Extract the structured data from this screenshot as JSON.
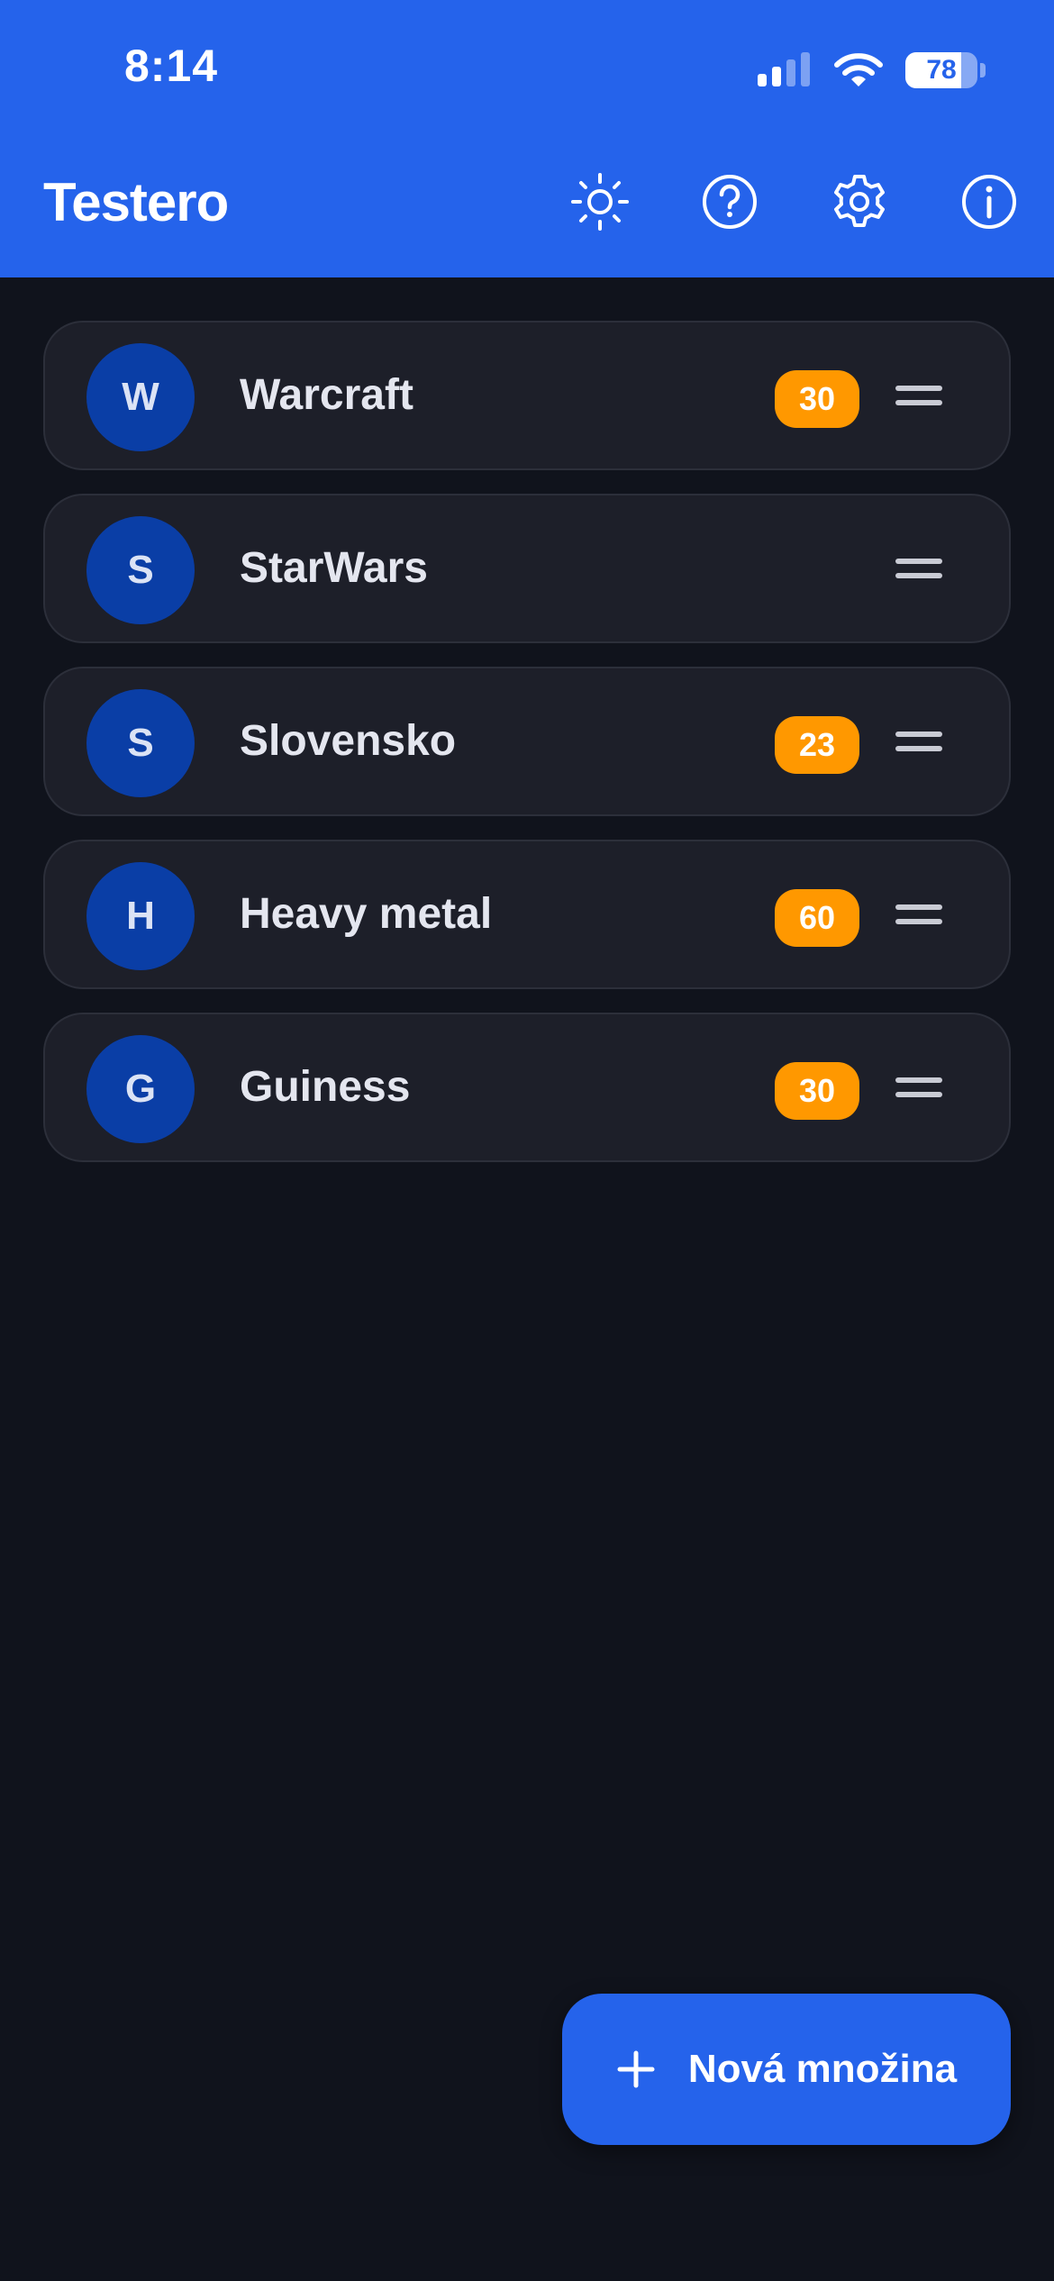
{
  "status_bar": {
    "time": "8:14",
    "battery": "78",
    "battery_level": 0.78
  },
  "header": {
    "title": "Testero",
    "icons": [
      "sun-icon",
      "help-icon",
      "settings-icon",
      "info-icon"
    ]
  },
  "sets": [
    {
      "initial": "W",
      "name": "Warcraft",
      "count": "30"
    },
    {
      "initial": "S",
      "name": "StarWars",
      "count": ""
    },
    {
      "initial": "S",
      "name": "Slovensko",
      "count": "23"
    },
    {
      "initial": "H",
      "name": "Heavy metal",
      "count": "60"
    },
    {
      "initial": "G",
      "name": "Guiness",
      "count": "30"
    }
  ],
  "fab": {
    "label": "Nová množina"
  },
  "colors": {
    "accent": "#2563eb",
    "background": "#10131c",
    "card": "#1d1f29",
    "avatar": "#0a3ea6",
    "badge": "#ff9800"
  }
}
